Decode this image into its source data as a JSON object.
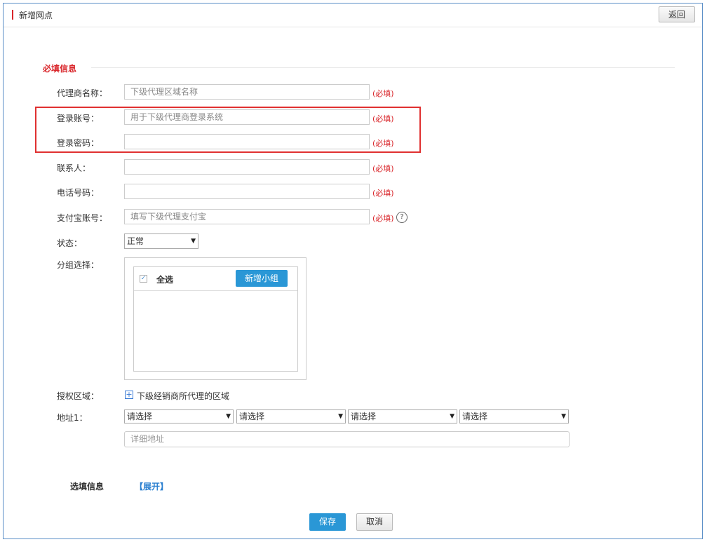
{
  "header": {
    "title": "新增网点",
    "back_label": "返回"
  },
  "required_section": {
    "title": "必填信息"
  },
  "fields": {
    "agent_name": {
      "label": "代理商名称：",
      "placeholder": "下级代理区域名称",
      "required": "(必填)"
    },
    "login_account": {
      "label": "登录账号：",
      "placeholder": "用于下级代理商登录系统",
      "required": "(必填)"
    },
    "login_password": {
      "label": "登录密码：",
      "placeholder": "",
      "required": "(必填)"
    },
    "contact": {
      "label": "联系人：",
      "placeholder": "",
      "required": "(必填)"
    },
    "phone": {
      "label": "电话号码：",
      "placeholder": "",
      "required": "(必填)"
    },
    "alipay": {
      "label": "支付宝账号：",
      "placeholder": "填写下级代理支付宝",
      "required": "(必填)",
      "help_icon": "?"
    },
    "status": {
      "label": "状态：",
      "value": "正常"
    },
    "group": {
      "label": "分组选择：",
      "select_all": "全选",
      "add_group_label": "新增小组",
      "select_all_checked": true
    },
    "auth_region": {
      "label": "授权区域：",
      "action_text": "下级经销商所代理的区域"
    },
    "address": {
      "label": "地址1：",
      "selects": [
        "请选择",
        "请选择",
        "请选择",
        "请选择"
      ],
      "detail_placeholder": "详细地址"
    }
  },
  "optional_section": {
    "title": "选填信息",
    "expand_label": "【展开】"
  },
  "actions": {
    "save_label": "保存",
    "cancel_label": "取消"
  },
  "colors": {
    "accent_red": "#d9262b",
    "primary_blue": "#2a97d6",
    "link_blue": "#2a7fd0"
  }
}
